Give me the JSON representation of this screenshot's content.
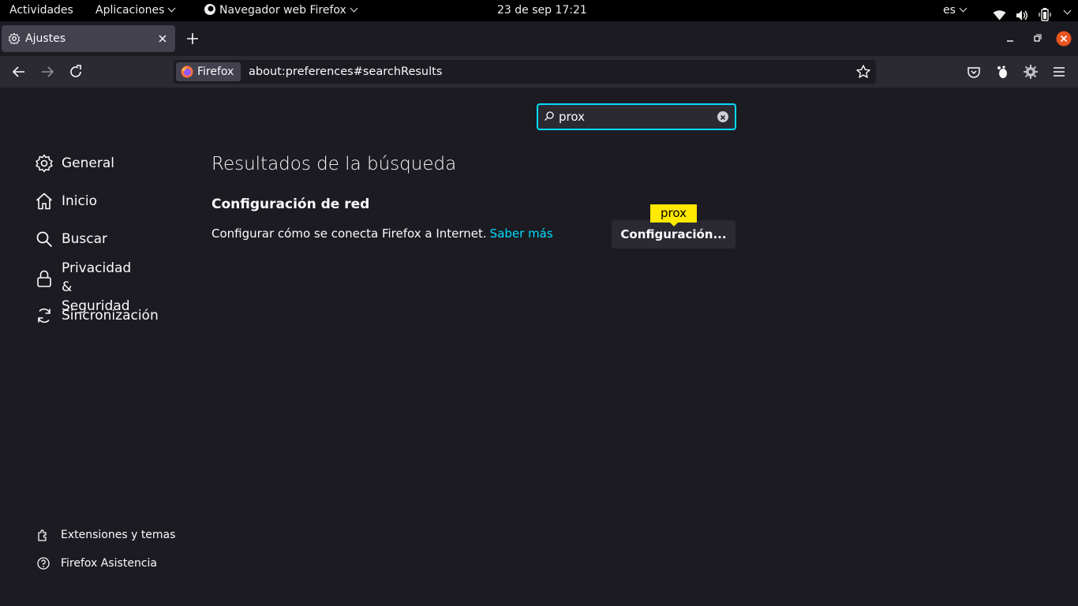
{
  "topbar": {
    "activities": "Actividades",
    "applications": "Aplicaciones",
    "app_name": "Navegador web Firefox",
    "datetime": "23 de sep  17:21",
    "language": "es"
  },
  "tab": {
    "title": "Ajustes"
  },
  "urlbar": {
    "identity": "Firefox",
    "url": "about:preferences#searchResults"
  },
  "search": {
    "value": "prox"
  },
  "sidebar": {
    "items": [
      {
        "label": "General",
        "icon": "gear-icon"
      },
      {
        "label": "Inicio",
        "icon": "home-icon"
      },
      {
        "label": "Buscar",
        "icon": "search-icon"
      },
      {
        "label": "Privacidad &\nSeguridad",
        "icon": "lock-icon"
      },
      {
        "label": "Sincronización",
        "icon": "sync-icon"
      }
    ],
    "footer": [
      {
        "label": "Extensiones y temas",
        "icon": "puzzle-icon"
      },
      {
        "label": "Firefox Asistencia",
        "icon": "help-icon"
      }
    ]
  },
  "main": {
    "results_title": "Resultados de la búsqueda",
    "section_title": "Configuración de red",
    "description": "Configurar cómo se conecta Firefox a Internet.",
    "learn_more": "Saber más",
    "settings_button": "Configuración...",
    "highlight_tooltip": "prox"
  },
  "colors": {
    "accent": "#00ddff",
    "highlight": "#ffe900",
    "background": "#1c1b22"
  }
}
